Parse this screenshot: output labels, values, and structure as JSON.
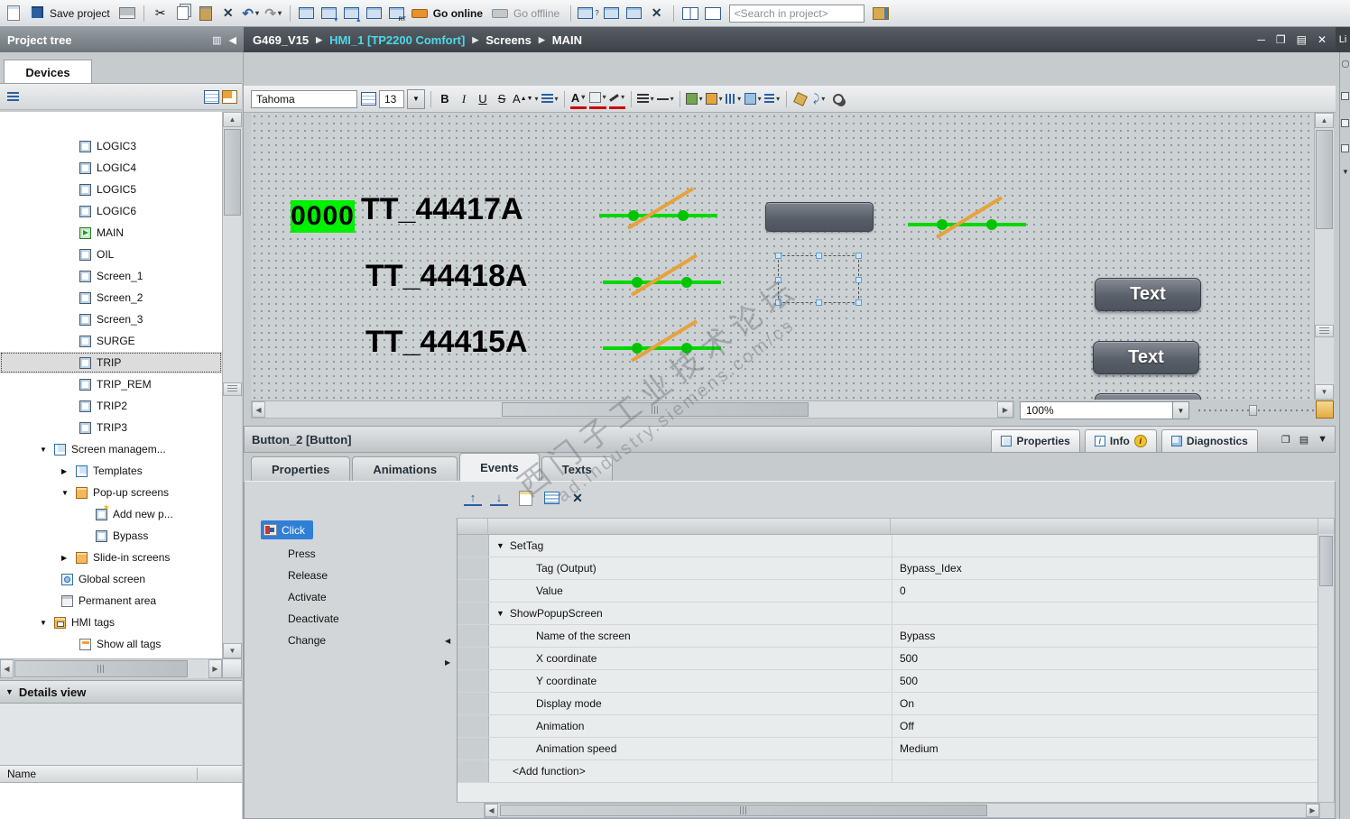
{
  "top_toolbar": {
    "save_label": "Save project",
    "go_online_label": "Go online",
    "go_offline_label": "Go offline",
    "search_placeholder": "<Search in project>"
  },
  "breadcrumb": {
    "project": "G469_V15",
    "device": "HMI_1 [TP2200 Comfort]",
    "section": "Screens",
    "screen": "MAIN"
  },
  "right_strip": {
    "top_label": "Li"
  },
  "project_tree": {
    "header": "Project tree",
    "tab": "Devices",
    "items": [
      {
        "label": "LOGIC3"
      },
      {
        "label": "LOGIC4"
      },
      {
        "label": "LOGIC5"
      },
      {
        "label": "LOGIC6"
      },
      {
        "label": "MAIN"
      },
      {
        "label": "OIL"
      },
      {
        "label": "Screen_1"
      },
      {
        "label": "Screen_2"
      },
      {
        "label": "Screen_3"
      },
      {
        "label": "SURGE"
      },
      {
        "label": "TRIP"
      },
      {
        "label": "TRIP_REM"
      },
      {
        "label": "TRIP2"
      },
      {
        "label": "TRIP3"
      },
      {
        "label": "Screen managem..."
      },
      {
        "label": "Templates"
      },
      {
        "label": "Pop-up screens"
      },
      {
        "label": "Add new p..."
      },
      {
        "label": "Bypass"
      },
      {
        "label": "Slide-in screens"
      },
      {
        "label": "Global screen"
      },
      {
        "label": "Permanent area"
      },
      {
        "label": "HMI tags"
      },
      {
        "label": "Show all tags"
      }
    ],
    "details_view": {
      "header": "Details view",
      "column": "Name"
    }
  },
  "format_toolbar": {
    "font_family": "Tahoma",
    "font_size": "13"
  },
  "screen_editor": {
    "io_field_value": "0000",
    "tag_labels": [
      "TT_44417A",
      "TT_44418A",
      "TT_44415A"
    ],
    "button_labels": [
      "Text",
      "Text"
    ],
    "zoom_value": "100%",
    "watermark_line1": "西门子工业技术论坛",
    "watermark_line2": "ad.industry.siemens.com/cs"
  },
  "colors": {
    "io_field_green": "#00f000",
    "switch_green": "#00d200",
    "switch_orange": "#e6a23c",
    "selection_blue": "#2f7fd6",
    "breadcrumb_device_cyan": "#4fd8e8"
  },
  "inspector": {
    "title": "Button_2 [Button]",
    "header_tabs": [
      "Properties",
      "Info",
      "Diagnostics"
    ],
    "tabs": [
      "Properties",
      "Animations",
      "Events",
      "Texts"
    ],
    "active_tab": "Events",
    "events": [
      "Click",
      "Press",
      "Release",
      "Activate",
      "Deactivate",
      "Change"
    ],
    "selected_event": "Click",
    "function_rows": [
      {
        "type": "group",
        "name": "SetTag"
      },
      {
        "type": "param",
        "label": "Tag (Output)",
        "value": "Bypass_Idex"
      },
      {
        "type": "param",
        "label": "Value",
        "value": "0"
      },
      {
        "type": "group",
        "name": "ShowPopupScreen"
      },
      {
        "type": "param",
        "label": "Name of the screen",
        "value": "Bypass"
      },
      {
        "type": "param",
        "label": "X coordinate",
        "value": "500"
      },
      {
        "type": "param",
        "label": "Y coordinate",
        "value": "500"
      },
      {
        "type": "param",
        "label": "Display mode",
        "value": "On"
      },
      {
        "type": "param",
        "label": "Animation",
        "value": "Off"
      },
      {
        "type": "param",
        "label": "Animation speed",
        "value": "Medium"
      },
      {
        "type": "add",
        "label": "<Add function>"
      }
    ]
  }
}
